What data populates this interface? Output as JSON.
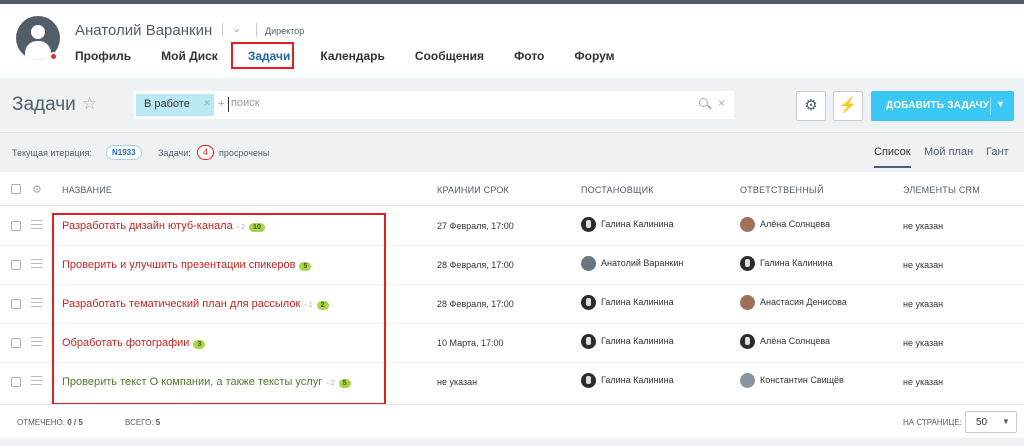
{
  "profile": {
    "name": "Анатолий Варанкин",
    "role": "Директор",
    "nav": [
      "Профиль",
      "Мой Диск",
      "Задачи",
      "Календарь",
      "Сообщения",
      "Фото",
      "Форум"
    ],
    "active_nav": "Задачи"
  },
  "page": {
    "title": "Задачи",
    "filter_chip": "В работе",
    "search_placeholder": "поиск",
    "add_button": "ДОБАВИТЬ ЗАДАЧУ"
  },
  "info": {
    "iteration_label": "Текущая итерация:",
    "iteration_value": "N1933",
    "tasks_label": "Задачи:",
    "overdue_count": "4",
    "overdue_label": "просрочены",
    "views": [
      "Список",
      "Мой план",
      "Гант"
    ],
    "active_view": "Список"
  },
  "table": {
    "headers": [
      "НАЗВАНИЕ",
      "КРАИНИИ СРОК",
      "ПОСТАНОВЩИК",
      "ОТВЕТСТВЕННЫЙ",
      "ЭЛЕМЕНТЫ CRM"
    ],
    "rows": [
      {
        "title": "Разработать дизайн ютуб-канала",
        "comments": "2",
        "badge": "10",
        "deadline": "27 Февраля, 17:00",
        "creator": "Галина Калинина",
        "responsible": "Алёна Солнцева",
        "crm": "не указан",
        "color": "red"
      },
      {
        "title": "Проверить и улучшить презентации спикеров",
        "comments": "",
        "badge": "5",
        "deadline": "28 Февраля, 17:00",
        "creator": "Анатолий Варанкин",
        "responsible": "Галина Калинина",
        "crm": "не указан",
        "color": "red"
      },
      {
        "title": "Разработать тематический план для рассылок",
        "comments": "1",
        "badge": "2",
        "deadline": "28 Февраля, 17:00",
        "creator": "Галина Калинина",
        "responsible": "Анастасия Денисова",
        "crm": "не указан",
        "color": "red"
      },
      {
        "title": "Обработать фотографии",
        "comments": "",
        "badge": "3",
        "deadline": "10 Марта, 17:00",
        "creator": "Галина Калинина",
        "responsible": "Алёна Солнцева",
        "crm": "не указан",
        "color": "red"
      },
      {
        "title": "Проверить текст О компании, а также тексты услуг",
        "comments": "2",
        "badge": "5",
        "deadline": "не указан",
        "creator": "Галина Калинина",
        "responsible": "Константин Свищёв",
        "crm": "не указан",
        "color": "green"
      }
    ]
  },
  "footer": {
    "checked_label": "ОТМЕЧЕНО:",
    "checked_value": "0 / 5",
    "total_label": "ВСЕГО:",
    "total_value": "5",
    "per_page_label": "НА СТРАНИЦЕ:",
    "per_page_value": "50"
  },
  "colors": {
    "accent": "#3bc8f5",
    "link_blue": "#2067b0",
    "overdue_red": "#c4241f",
    "ok_green": "#4d7a2a",
    "highlight": "#e02020"
  }
}
